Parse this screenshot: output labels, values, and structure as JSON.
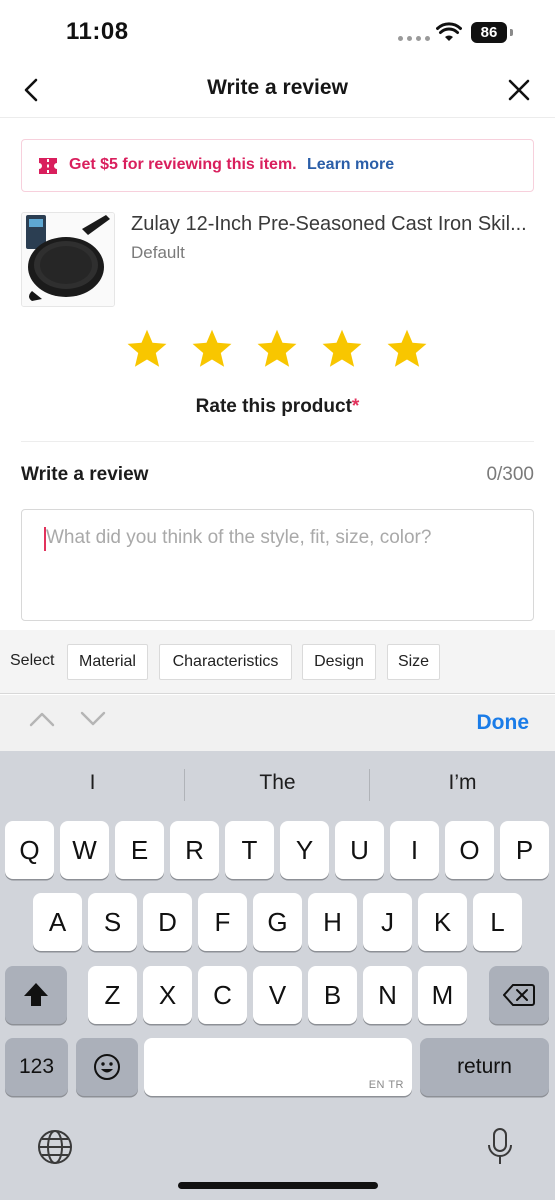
{
  "status_bar": {
    "time": "11:08",
    "battery": "86"
  },
  "header": {
    "title": "Write a review",
    "back_icon": "chevron-left-icon",
    "close_icon": "close-icon"
  },
  "promo": {
    "text": "Get $5 for reviewing this item.",
    "link": "Learn more",
    "icon": "ticket-icon",
    "accent": "#d91f5d",
    "link_color": "#2a5ea8"
  },
  "product": {
    "name": "Zulay 12-Inch Pre-Seasoned Cast Iron Skil...",
    "variant": "Default"
  },
  "rating": {
    "stars_filled": 5,
    "stars_total": 5,
    "label": "Rate this product",
    "required_mark": "*",
    "star_color": "#f8c600"
  },
  "review": {
    "label": "Write a review",
    "count": "0/300",
    "placeholder": "What did you think of the style, fit, size, color?"
  },
  "chips": {
    "select_label": "Select",
    "items": [
      "Material",
      "Characteristics",
      "Design",
      "Size"
    ]
  },
  "keyboard_toolbar": {
    "done": "Done",
    "done_color": "#1a7ce8"
  },
  "keyboard": {
    "suggestions": [
      "I",
      "The",
      "I’m"
    ],
    "row1": [
      "Q",
      "W",
      "E",
      "R",
      "T",
      "Y",
      "U",
      "I",
      "O",
      "P"
    ],
    "row2": [
      "A",
      "S",
      "D",
      "F",
      "G",
      "H",
      "J",
      "K",
      "L"
    ],
    "row3": [
      "Z",
      "X",
      "C",
      "V",
      "B",
      "N",
      "M"
    ],
    "numbers_key": "123",
    "return_key": "return",
    "space_hint": "EN TR"
  }
}
